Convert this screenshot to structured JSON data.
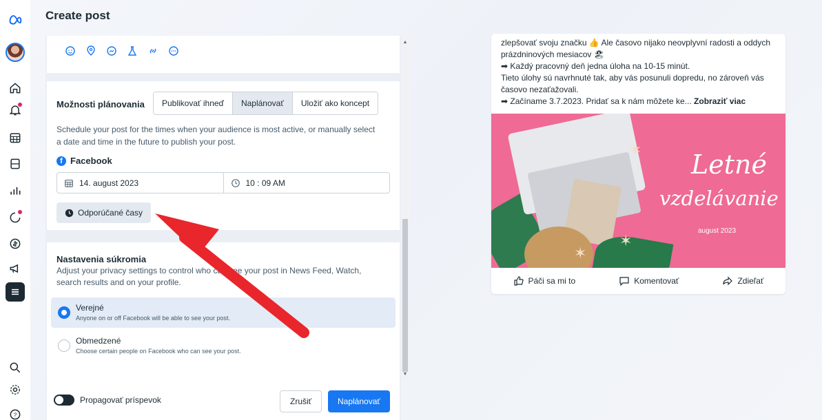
{
  "page": {
    "title": "Create post"
  },
  "rail": {
    "items": [
      "home-icon",
      "notifications-icon",
      "calendar-icon",
      "content-icon",
      "insights-icon",
      "inbox-icon",
      "monetization-icon",
      "ads-icon",
      "menu-icon",
      "search-icon",
      "settings-icon",
      "help-icon"
    ]
  },
  "tools": [
    "emoji-icon",
    "location-icon",
    "messenger-icon",
    "lab-icon",
    "link-icon",
    "more-icon"
  ],
  "schedule": {
    "label": "Možnosti plánovania",
    "tabs": [
      "Publikovať ihneď",
      "Naplánovať",
      "Uložiť ako koncept"
    ],
    "selected_tab": "Naplánovať",
    "description": "Schedule your post for the times when your audience is most active, or manually select a date and time in the future to publish your post.",
    "platform": "Facebook",
    "date": "14. august 2023",
    "time": "10 : 09 AM",
    "recommended_label": "Odporúčané časy"
  },
  "privacy": {
    "title": "Nastavenia súkromia",
    "description": "Adjust your privacy settings to control who can see your post in News Feed, Watch, search results and on your profile.",
    "options": [
      {
        "label": "Verejné",
        "sub": "Anyone on or off Facebook will be able to see your post.",
        "selected": true
      },
      {
        "label": "Obmedzené",
        "sub": "Choose certain people on Facebook who can see your post.",
        "selected": false
      }
    ]
  },
  "footer": {
    "promote_label": "Propagovať príspevok",
    "cancel_label": "Zrušiť",
    "schedule_label": "Naplánovať"
  },
  "preview": {
    "line1": "zlepšovať svoju značku 👍 Ale časovo nijako neovplyvní radosti a oddych prázdninových mesiacov 🏖",
    "line2": "➡ Každý pracovný deň jedna úloha na 10-15 minút.",
    "line3": "Tieto úlohy sú navrhnuté tak, aby vás posunuli dopredu, no zároveň vás časovo nezaťažovali.",
    "line4": "➡ Začíname 3.7.2023. Pridať sa k nám môžete ke...",
    "see_more": "Zobraziť viac",
    "image_title1": "Letné",
    "image_title2": "vzdelávanie",
    "image_sub": "august 2023",
    "actions": [
      "Páči sa mi to",
      "Komentovať",
      "Zdieľať"
    ]
  },
  "colors": {
    "accent": "#1877f2",
    "annotation_arrow": "#e8262b",
    "image_bg": "#ef6a94"
  }
}
